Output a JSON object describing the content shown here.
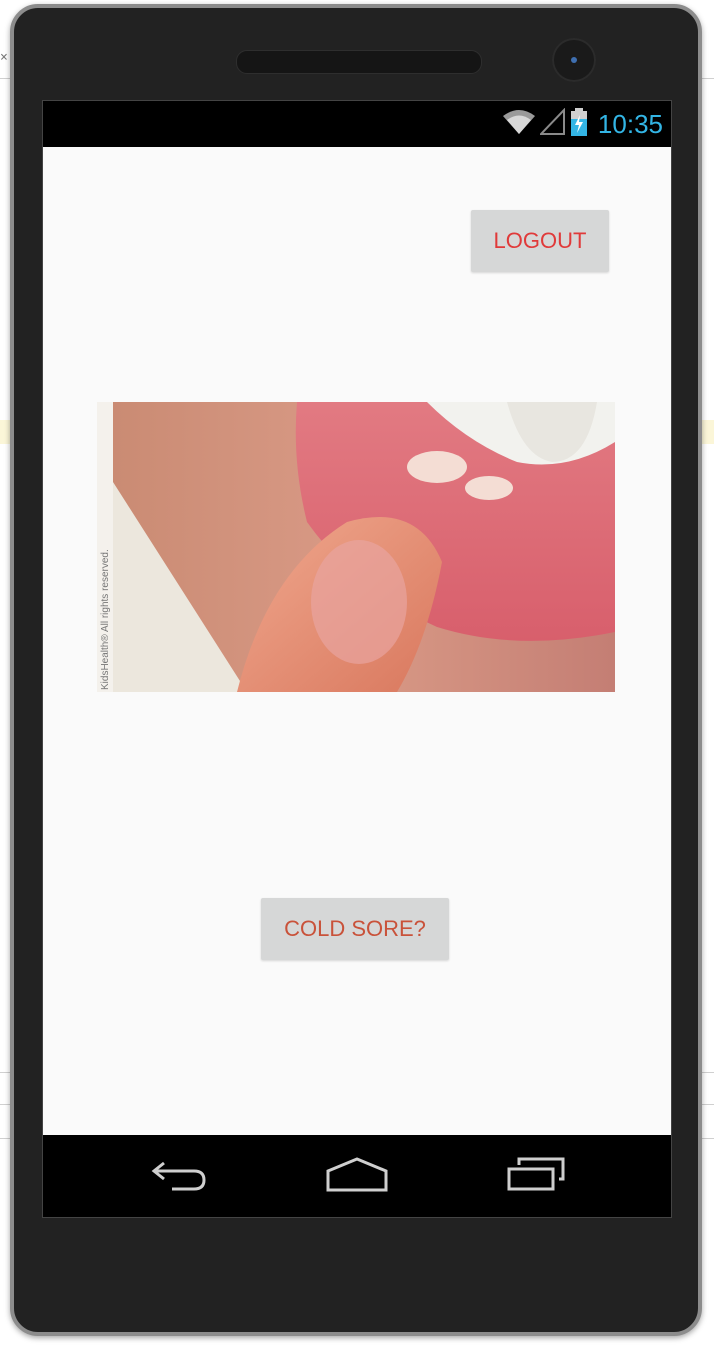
{
  "status_bar": {
    "time": "10:35",
    "clock_color": "#33b5e5"
  },
  "toolbar": {
    "logout_label": "LOGOUT"
  },
  "main": {
    "image_watermark": "KidsHealth® All rights reserved.",
    "cold_sore_label": "COLD SORE?"
  },
  "nav": {
    "icons": [
      "back-icon",
      "home-icon",
      "recent-apps-icon"
    ]
  },
  "colors": {
    "logout_text": "#e03a3a",
    "cold_sore_text": "#c9523a",
    "button_bg": "#d6d7d7",
    "app_bg": "#fafafa"
  }
}
